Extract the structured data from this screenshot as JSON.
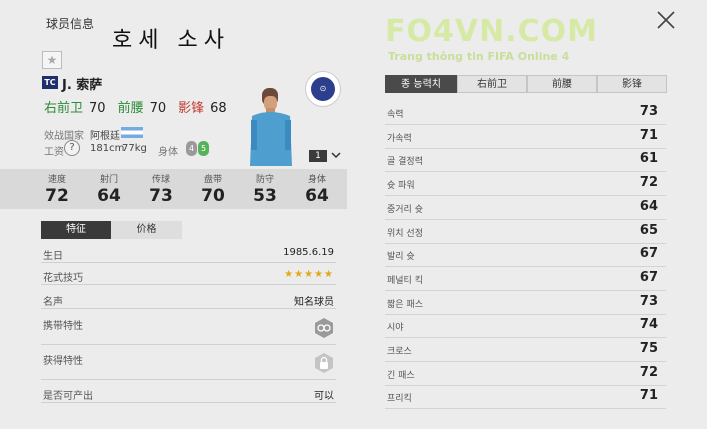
{
  "header": {
    "title": "球员信息",
    "player_korean_name": "호세 소사"
  },
  "player": {
    "season_badge": "TC",
    "name": "J. 索萨",
    "positions": [
      {
        "pos": "右前卫",
        "ovr": "70"
      },
      {
        "pos": "前腰",
        "ovr": "70"
      },
      {
        "pos": "影锋",
        "ovr": "68"
      }
    ],
    "nation_label": "效战国家",
    "nation_value": "阿根廷",
    "wage_label": "工资",
    "wage_value": "?",
    "height": "181cm",
    "weight": "77kg",
    "body_label": "身体",
    "weak_foot": "4",
    "skill_moves": "5",
    "level": "1",
    "club_emblem": "⊙"
  },
  "stats_bar": [
    {
      "label": "速度",
      "value": "72"
    },
    {
      "label": "射门",
      "value": "64"
    },
    {
      "label": "传球",
      "value": "73"
    },
    {
      "label": "盘带",
      "value": "70"
    },
    {
      "label": "防守",
      "value": "53"
    },
    {
      "label": "身体",
      "value": "64"
    }
  ],
  "left_tabs": [
    "特征",
    "价格"
  ],
  "details": [
    {
      "key": "生日",
      "value": "1985.6.19"
    },
    {
      "key": "花式技巧",
      "value": "★★★★★"
    },
    {
      "key": "名声",
      "value": "知名球员"
    },
    {
      "key": "携带特性",
      "value": ""
    },
    {
      "key": "获得特性",
      "value": ""
    },
    {
      "key": "是否可产出",
      "value": "可以"
    }
  ],
  "brand": {
    "logo": "FO4VN.COM",
    "tagline": "Trang thông tin FIFA Online 4"
  },
  "right_tabs": [
    "종 능력치",
    "右前卫",
    "前腰",
    "影锋"
  ],
  "attributes": [
    {
      "name": "속력",
      "value": "73"
    },
    {
      "name": "가속력",
      "value": "71"
    },
    {
      "name": "골 결정력",
      "value": "61"
    },
    {
      "name": "슛 파워",
      "value": "72"
    },
    {
      "name": "중거리 슛",
      "value": "64"
    },
    {
      "name": "위치 선정",
      "value": "65"
    },
    {
      "name": "발리 슛",
      "value": "67"
    },
    {
      "name": "페널티 킥",
      "value": "67"
    },
    {
      "name": "짧은 패스",
      "value": "73"
    },
    {
      "name": "시야",
      "value": "74"
    },
    {
      "name": "크로스",
      "value": "75"
    },
    {
      "name": "긴 패스",
      "value": "72"
    },
    {
      "name": "프리킥",
      "value": "71"
    }
  ]
}
